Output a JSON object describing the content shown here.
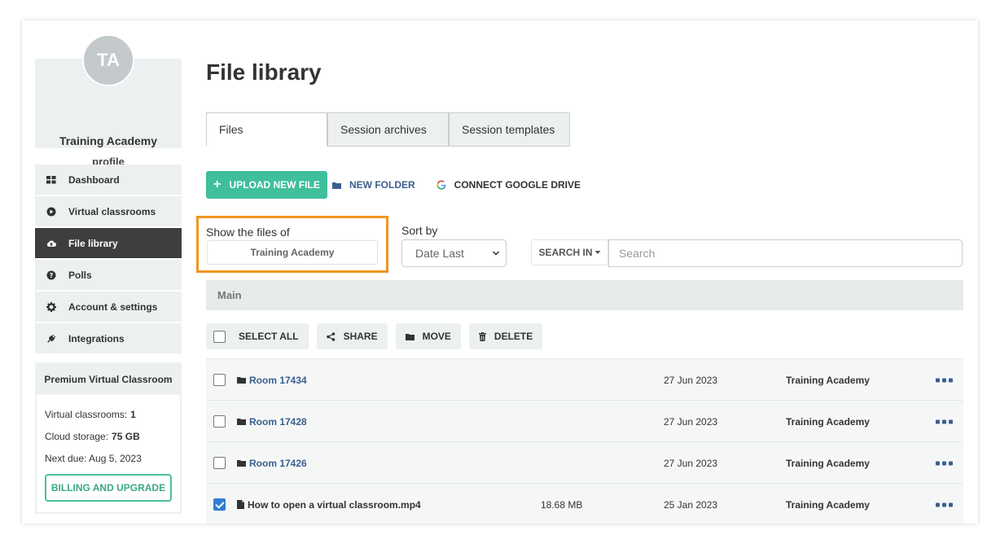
{
  "sidebar": {
    "avatar_initials": "TA",
    "profile_name": "Training Academy",
    "profile_link": "profile",
    "nav": [
      {
        "label": "Dashboard",
        "icon": "dashboard-icon"
      },
      {
        "label": "Virtual classrooms",
        "icon": "play-circle-icon"
      },
      {
        "label": "File library",
        "icon": "cloud-upload-icon",
        "active": true
      },
      {
        "label": "Polls",
        "icon": "question-circle-icon"
      },
      {
        "label": "Account & settings",
        "icon": "gear-icon"
      },
      {
        "label": "Integrations",
        "icon": "plug-icon"
      }
    ],
    "premium": {
      "title": "Premium Virtual Classroom",
      "classrooms_label": "Virtual classrooms:",
      "classrooms_value": "1",
      "storage_label": "Cloud storage:",
      "storage_value": "75 GB",
      "next_due": "Next due: Aug 5, 2023",
      "billing_button": "BILLING AND UPGRADE"
    }
  },
  "main": {
    "title": "File library",
    "tabs": [
      {
        "label": "Files",
        "active": true
      },
      {
        "label": "Session archives"
      },
      {
        "label": "Session templates"
      }
    ],
    "actions": {
      "upload": "UPLOAD NEW FILE",
      "new_folder": "NEW FOLDER",
      "google_drive": "CONNECT GOOGLE DRIVE"
    },
    "filters": {
      "owner_label": "Show the files of",
      "owner_value": "Training Academy",
      "sort_label": "Sort by",
      "sort_value": "Date Last",
      "search_in": "SEARCH IN",
      "search_placeholder": "Search"
    },
    "folder_header": "Main",
    "bulk": {
      "select_all": "SELECT ALL",
      "share": "SHARE",
      "move": "MOVE",
      "delete": "DELETE"
    },
    "files": [
      {
        "name": "Room 17434",
        "type": "folder",
        "size": "",
        "date": "27 Jun 2023",
        "owner": "Training Academy",
        "checked": false
      },
      {
        "name": "Room 17428",
        "type": "folder",
        "size": "",
        "date": "27 Jun 2023",
        "owner": "Training Academy",
        "checked": false
      },
      {
        "name": "Room 17426",
        "type": "folder",
        "size": "",
        "date": "27 Jun 2023",
        "owner": "Training Academy",
        "checked": false
      },
      {
        "name": "How to open a virtual classroom.mp4",
        "type": "file",
        "size": "18.68 MB",
        "date": "25 Jan 2023",
        "owner": "Training Academy",
        "checked": true
      }
    ]
  },
  "colors": {
    "accent_green": "#3fbf9c",
    "nav_active": "#3e3e3e",
    "highlight_orange": "#f0961e",
    "link_blue": "#3a5f90",
    "checkbox_blue": "#2f7dd1"
  }
}
